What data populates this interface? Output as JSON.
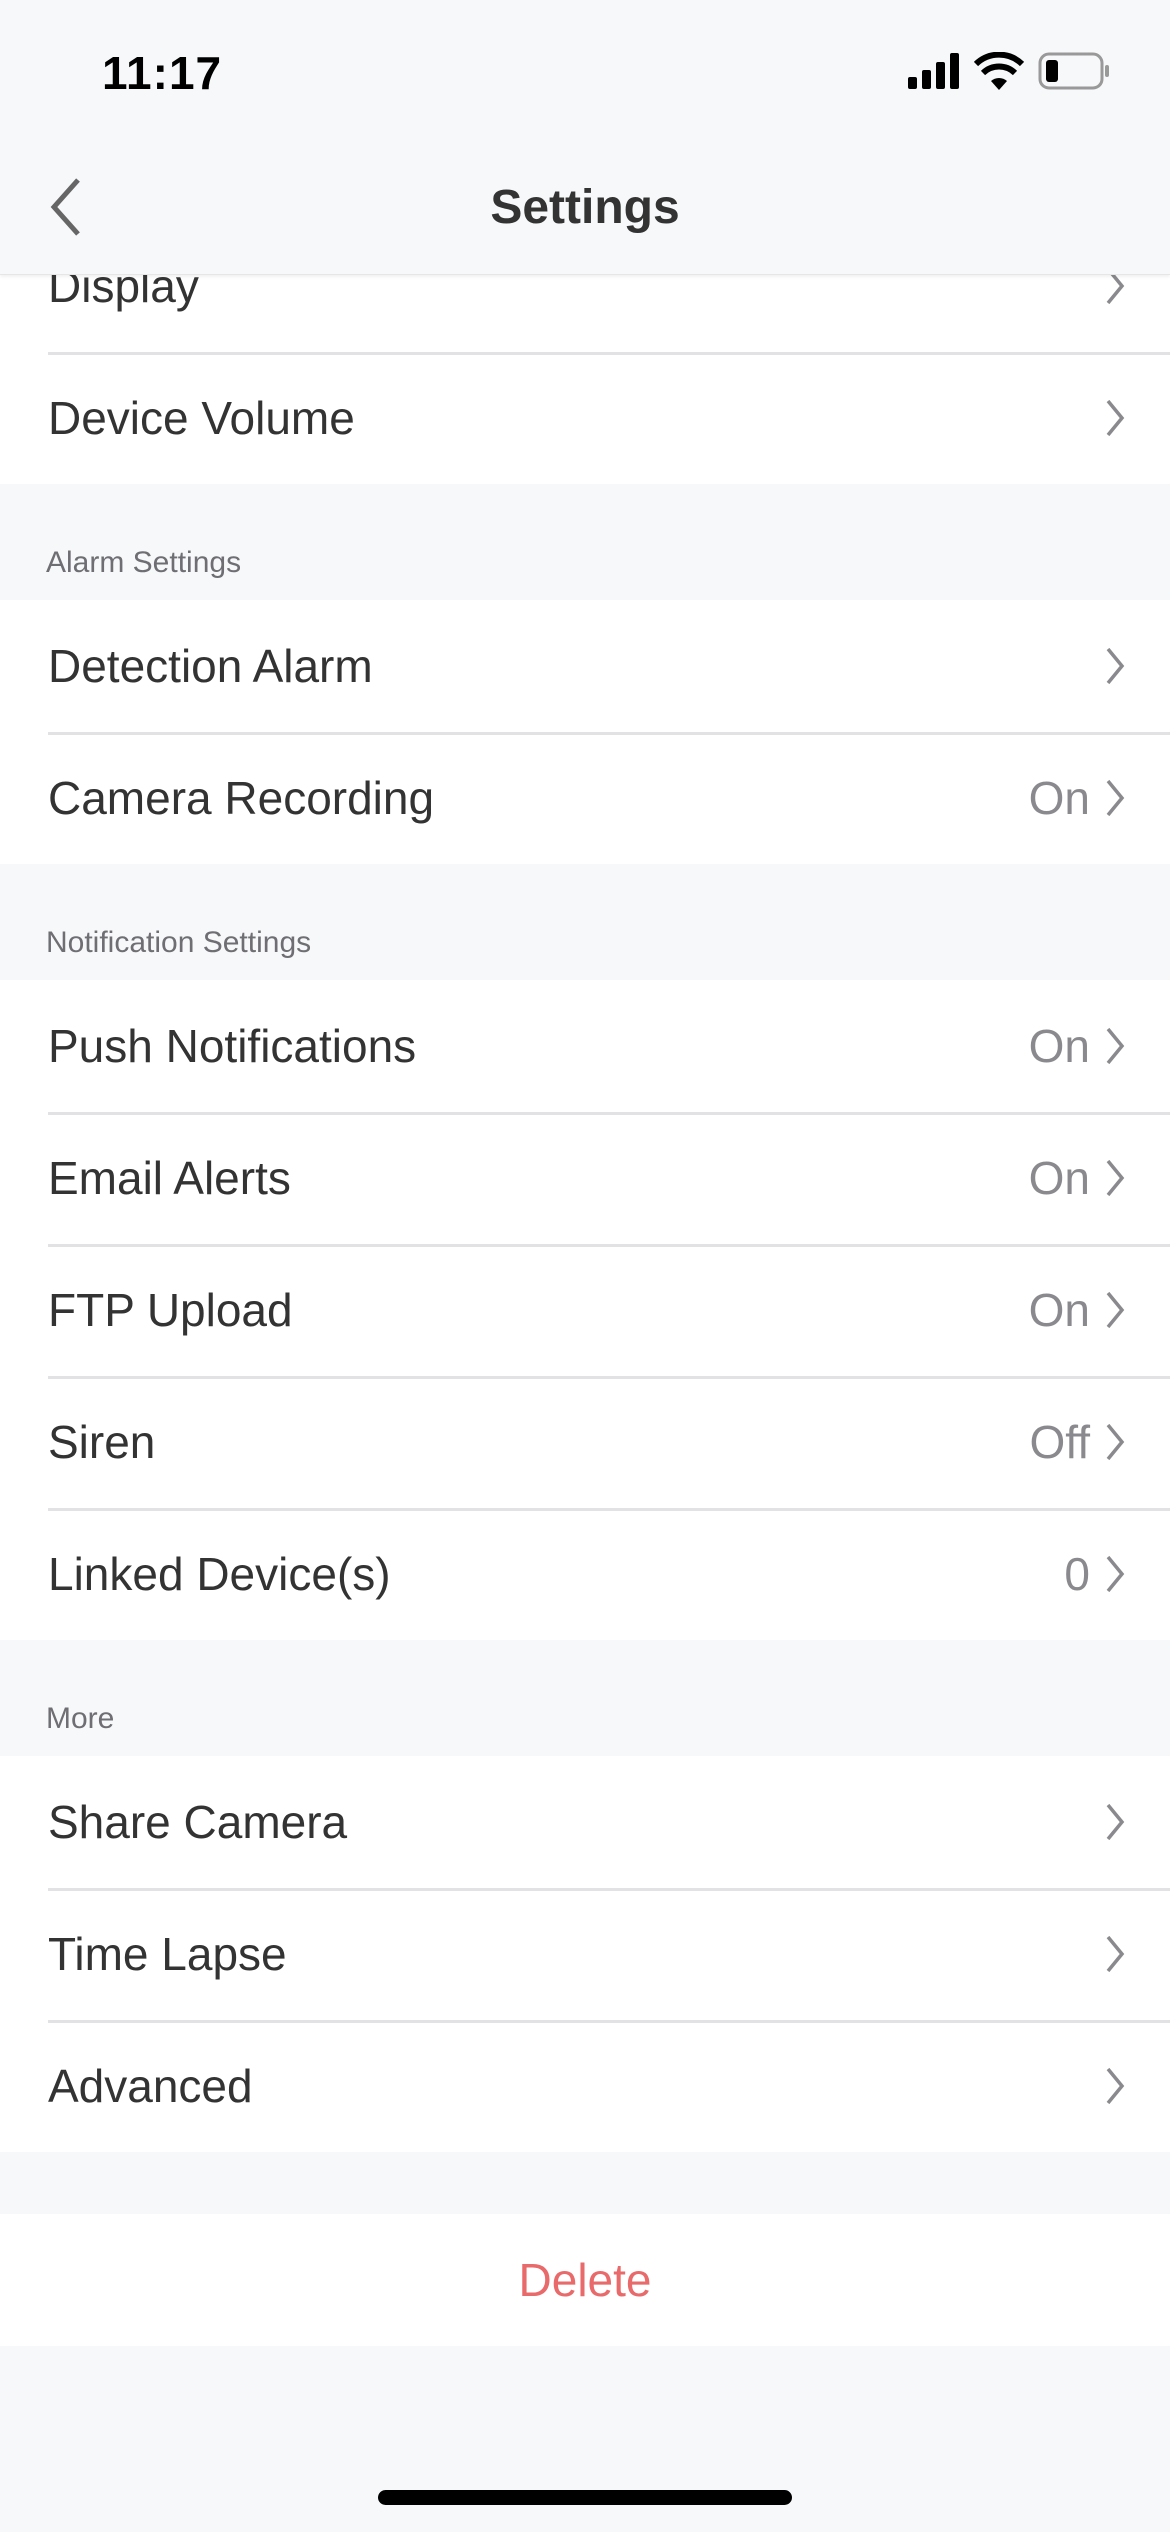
{
  "status_bar": {
    "time": "11:17",
    "icons": [
      "cellular-signal-icon",
      "wifi-icon",
      "battery-low-icon"
    ]
  },
  "nav": {
    "title": "Settings",
    "back_icon": "chevron-left-icon"
  },
  "groups": [
    {
      "header": "",
      "rows": [
        {
          "label": "Display",
          "value": ""
        },
        {
          "label": "Device Volume",
          "value": ""
        }
      ]
    },
    {
      "header": "Alarm Settings",
      "rows": [
        {
          "label": "Detection Alarm",
          "value": ""
        },
        {
          "label": "Camera Recording",
          "value": "On"
        }
      ]
    },
    {
      "header": "Notification Settings",
      "rows": [
        {
          "label": "Push Notifications",
          "value": "On"
        },
        {
          "label": "Email Alerts",
          "value": "On"
        },
        {
          "label": "FTP Upload",
          "value": "On"
        },
        {
          "label": "Siren",
          "value": "Off"
        },
        {
          "label": "Linked Device(s)",
          "value": "0"
        }
      ]
    },
    {
      "header": "More",
      "rows": [
        {
          "label": "Share Camera",
          "value": ""
        },
        {
          "label": "Time Lapse",
          "value": ""
        },
        {
          "label": "Advanced",
          "value": ""
        }
      ]
    }
  ],
  "delete_label": "Delete",
  "colors": {
    "background": "#f7f8fa",
    "delete": "#e96a6a",
    "text": "#333333",
    "value": "#8a8a8e"
  }
}
